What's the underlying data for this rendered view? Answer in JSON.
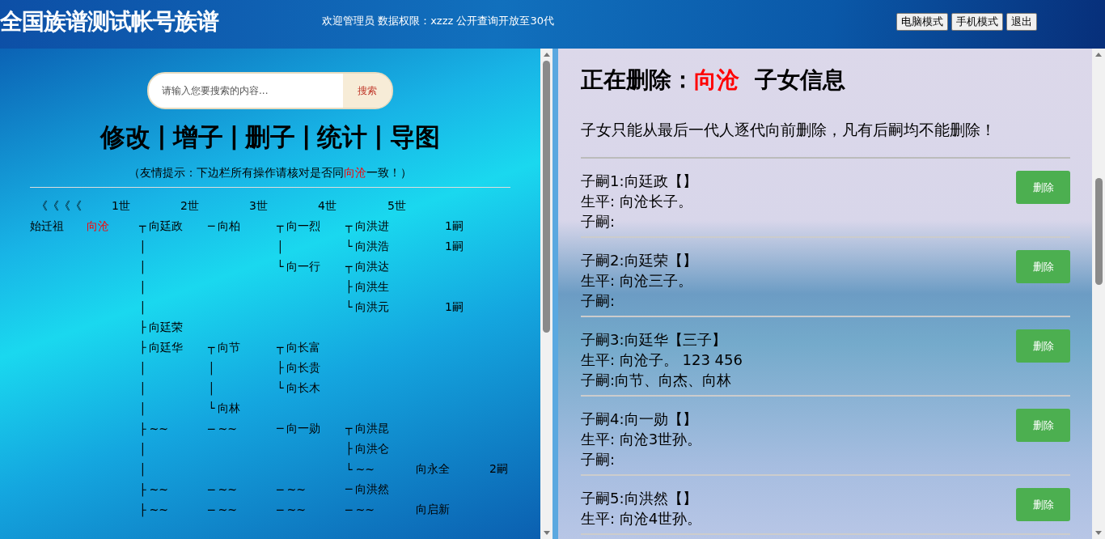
{
  "header": {
    "title": "全国族谱测试帐号族谱",
    "welcome": "欢迎管理员 数据权限：xzzz 公开查询开放至30代",
    "buttons": [
      "电脑模式",
      "手机模式",
      "退出"
    ]
  },
  "search": {
    "placeholder": "请输入您要搜索的内容...",
    "button": "搜索"
  },
  "nav": {
    "items": [
      "修改",
      "增子",
      "删子",
      "统计",
      "导图"
    ],
    "separator": "|"
  },
  "tip": {
    "before": "（友情提示：下边栏所有操作请核对是否同",
    "name": "向沧",
    "after": "一致！）"
  },
  "tree": {
    "back": "《《《《",
    "generations": [
      "1世",
      "2世",
      "3世",
      "4世",
      "5世"
    ],
    "rows": [
      {
        "cells": [
          {
            "name": "始迁祖"
          },
          {
            "name": "向沧",
            "current": true
          },
          {
            "conn": "┬",
            "name": "向廷政"
          },
          {
            "conn": "─",
            "name": "向柏"
          },
          {
            "conn": "┬",
            "name": "向一烈"
          },
          {
            "conn": "┬",
            "name": "向洪进"
          }
        ],
        "count": "1嗣"
      },
      {
        "cells": [
          null,
          null,
          {
            "conn": "│"
          },
          null,
          {
            "conn": "│"
          },
          {
            "conn": "└",
            "name": "向洪浩"
          }
        ],
        "count": "1嗣"
      },
      {
        "cells": [
          null,
          null,
          {
            "conn": "│"
          },
          null,
          {
            "conn": "└",
            "name": "向一行"
          },
          {
            "conn": "┬",
            "name": "向洪达"
          }
        ]
      },
      {
        "cells": [
          null,
          null,
          {
            "conn": "│"
          },
          null,
          null,
          {
            "conn": "├",
            "name": "向洪生"
          }
        ]
      },
      {
        "cells": [
          null,
          null,
          {
            "conn": "│"
          },
          null,
          null,
          {
            "conn": "└",
            "name": "向洪元"
          }
        ],
        "count": "1嗣"
      },
      {
        "cells": [
          null,
          null,
          {
            "conn": "├",
            "name": "向廷荣"
          }
        ]
      },
      {
        "cells": [
          null,
          null,
          {
            "conn": "├",
            "name": "向廷华"
          },
          {
            "conn": "┬",
            "name": "向节"
          },
          {
            "conn": "┬",
            "name": "向长富"
          }
        ]
      },
      {
        "cells": [
          null,
          null,
          {
            "conn": "│"
          },
          {
            "conn": "│"
          },
          {
            "conn": "├",
            "name": "向长贵"
          }
        ]
      },
      {
        "cells": [
          null,
          null,
          {
            "conn": "│"
          },
          {
            "conn": "│"
          },
          {
            "conn": "└",
            "name": "向长木"
          }
        ]
      },
      {
        "cells": [
          null,
          null,
          {
            "conn": "│"
          },
          {
            "conn": "└",
            "name": "向林"
          }
        ]
      },
      {
        "cells": [
          null,
          null,
          {
            "conn": "├",
            "name": "~~"
          },
          {
            "conn": "─",
            "name": "~~"
          },
          {
            "conn": "─",
            "name": "向一勋"
          },
          {
            "conn": "┬",
            "name": "向洪昆"
          }
        ]
      },
      {
        "cells": [
          null,
          null,
          {
            "conn": "│"
          },
          null,
          null,
          {
            "conn": "├",
            "name": "向洪仑"
          }
        ]
      },
      {
        "cells": [
          null,
          null,
          {
            "conn": "│"
          },
          null,
          null,
          {
            "conn": "└",
            "name": "~~"
          }
        ],
        "extra": "向永全",
        "count": "2嗣"
      },
      {
        "cells": [
          null,
          null,
          {
            "conn": "├",
            "name": "~~"
          },
          {
            "conn": "─",
            "name": "~~"
          },
          {
            "conn": "─",
            "name": "~~"
          },
          {
            "conn": "─",
            "name": "向洪然"
          }
        ]
      },
      {
        "cells": [
          null,
          null,
          {
            "conn": "├",
            "name": "~~"
          },
          {
            "conn": "─",
            "name": "~~"
          },
          {
            "conn": "─",
            "name": "~~"
          },
          {
            "conn": "─",
            "name": "~~"
          }
        ],
        "extra": "向启新"
      }
    ]
  },
  "detail": {
    "title_before": "正在删除：",
    "title_name": "向沧",
    "title_after": "子女信息",
    "note": "子女只能从最后一代人逐代向前删除，凡有后嗣均不能删除！",
    "children": [
      {
        "heading": "子嗣1:向廷政【】",
        "bio": "生平: 向沧长子。",
        "heirs": "子嗣:",
        "button": "删除"
      },
      {
        "heading": "子嗣2:向廷荣【】",
        "bio": "生平: 向沧三子。",
        "heirs": "子嗣:",
        "button": "删除"
      },
      {
        "heading": "子嗣3:向廷华【三子】",
        "bio": "生平: 向沧子。 123 456",
        "heirs": "子嗣:向节、向杰、向林",
        "button": "删除"
      },
      {
        "heading": "子嗣4:向一勋【】",
        "bio": "生平: 向沧3世孙。",
        "heirs": "子嗣:",
        "button": "删除"
      },
      {
        "heading": "子嗣5:向洪然【】",
        "bio": "生平: 向沧4世孙。",
        "button": "删除"
      }
    ]
  }
}
